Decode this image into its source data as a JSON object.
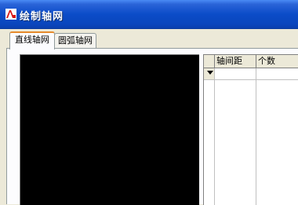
{
  "window": {
    "title": "绘制轴网",
    "icon": "autocad-app-icon"
  },
  "tabs": [
    {
      "label": "直线轴网",
      "active": true
    },
    {
      "label": "圆弧轴网",
      "active": false
    }
  ],
  "grid": {
    "columns": [
      "",
      "轴间距",
      "个数"
    ],
    "rows": [
      {
        "indicator": "current-row-arrow",
        "spacing": "",
        "count": ""
      }
    ]
  },
  "colors": {
    "titlebar": "#0b4cc8",
    "active_tab_accent": "#e68b2c",
    "canvas_background": "#000000"
  }
}
